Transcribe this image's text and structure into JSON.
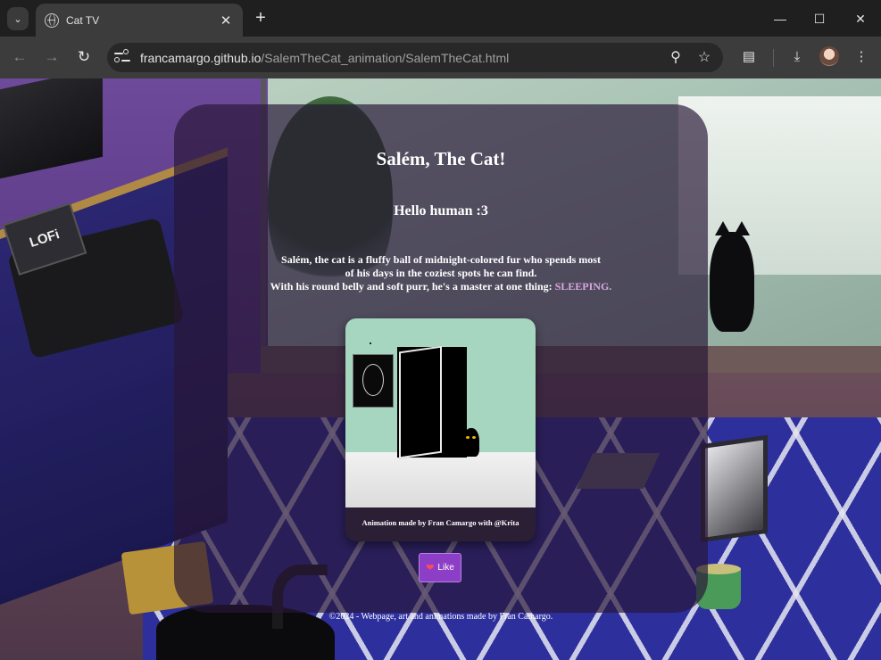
{
  "browser": {
    "tab_title": "Cat TV",
    "url_host": "francamargo.github.io",
    "url_path": "/SalemTheCat_animation/SalemTheCat.html"
  },
  "icons": {
    "tab_search": "chevron-down-icon",
    "favicon": "globe-icon",
    "close": "close-icon",
    "new_tab": "plus-icon",
    "back": "arrow-left-icon",
    "forward": "arrow-right-icon",
    "reload": "reload-icon",
    "site_info": "tune-icon",
    "zoom": "magnifier-icon",
    "bookmark": "star-icon",
    "extensions": "puzzle-icon",
    "downloads": "download-icon",
    "menu": "kebab-menu-icon",
    "like": "heart-icon"
  },
  "page": {
    "title": "Salém, The Cat!",
    "subtitle": "Hello human :3",
    "description_line1": "Salém, the cat is a fluffy ball of midnight-colored fur who spends most",
    "description_line2": "of his days in the coziest spots he can find.",
    "description_line3": "With his round belly and soft purr, he's a master at one thing: ",
    "description_highlight": "SLEEPING.",
    "animation_caption": "Animation made by Fran Camargo with @Krita",
    "like_label": "Like",
    "footer": "©2024 - Webpage, art and animations made by Fran Camargo.",
    "scene_lofi_sign": "LOFi"
  },
  "colors": {
    "card_bg": "rgba(40,22,55,0.68)",
    "highlight": "#d8a8e0",
    "like_button": "#8d3ec6",
    "heart": "#ff4b5c"
  }
}
